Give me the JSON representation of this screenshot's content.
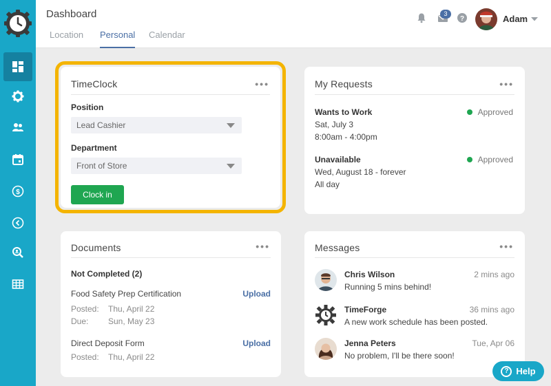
{
  "header": {
    "title": "Dashboard",
    "tabs": [
      {
        "label": "Location"
      },
      {
        "label": "Personal"
      },
      {
        "label": "Calendar"
      }
    ],
    "active_tab": "Personal",
    "mail_count": "3",
    "user_name": "Adam"
  },
  "sidebar": {
    "items": [
      {
        "icon": "dashboard-icon",
        "active": true
      },
      {
        "icon": "gear-icon"
      },
      {
        "icon": "users-icon"
      },
      {
        "icon": "calendar-icon"
      },
      {
        "icon": "dollar-icon"
      },
      {
        "icon": "chevron-left-icon"
      },
      {
        "icon": "search-user-icon"
      },
      {
        "icon": "table-icon"
      }
    ]
  },
  "timeclock": {
    "title": "TimeClock",
    "position_label": "Position",
    "position_value": "Lead Cashier",
    "department_label": "Department",
    "department_value": "Front of Store",
    "clock_in_label": "Clock in"
  },
  "requests": {
    "title": "My Requests",
    "items": [
      {
        "type": "Wants to Work",
        "line1": "Sat, July 3",
        "line2": "8:00am - 4:00pm",
        "status": "Approved"
      },
      {
        "type": "Unavailable",
        "line1": "Wed, August 18 - forever",
        "line2": "All day",
        "status": "Approved"
      }
    ]
  },
  "documents": {
    "title": "Documents",
    "section": "Not Completed (2)",
    "items": [
      {
        "name": "Food Safety Prep Certification",
        "action": "Upload",
        "meta": [
          {
            "k": "Posted:",
            "v": "Thu, April 22"
          },
          {
            "k": "Due:",
            "v": "Sun, May 23"
          }
        ]
      },
      {
        "name": "Direct Deposit Form",
        "action": "Upload",
        "meta": [
          {
            "k": "Posted:",
            "v": "Thu, April 22"
          }
        ]
      }
    ]
  },
  "messages": {
    "title": "Messages",
    "items": [
      {
        "name": "Chris Wilson",
        "text": "Running 5 mins behind!",
        "time": "2 mins ago"
      },
      {
        "name": "TimeForge",
        "text": "A new work schedule has been posted.",
        "time": "36 mins ago"
      },
      {
        "name": "Jenna Peters",
        "text": "No problem, I'll be there soon!",
        "time": "Tue, Apr 06"
      }
    ]
  },
  "help": {
    "label": "Help"
  },
  "colors": {
    "sidebar": "#19a7c8",
    "accent": "#4a6fa5",
    "highlight": "#f4b400",
    "success": "#1fa651"
  }
}
